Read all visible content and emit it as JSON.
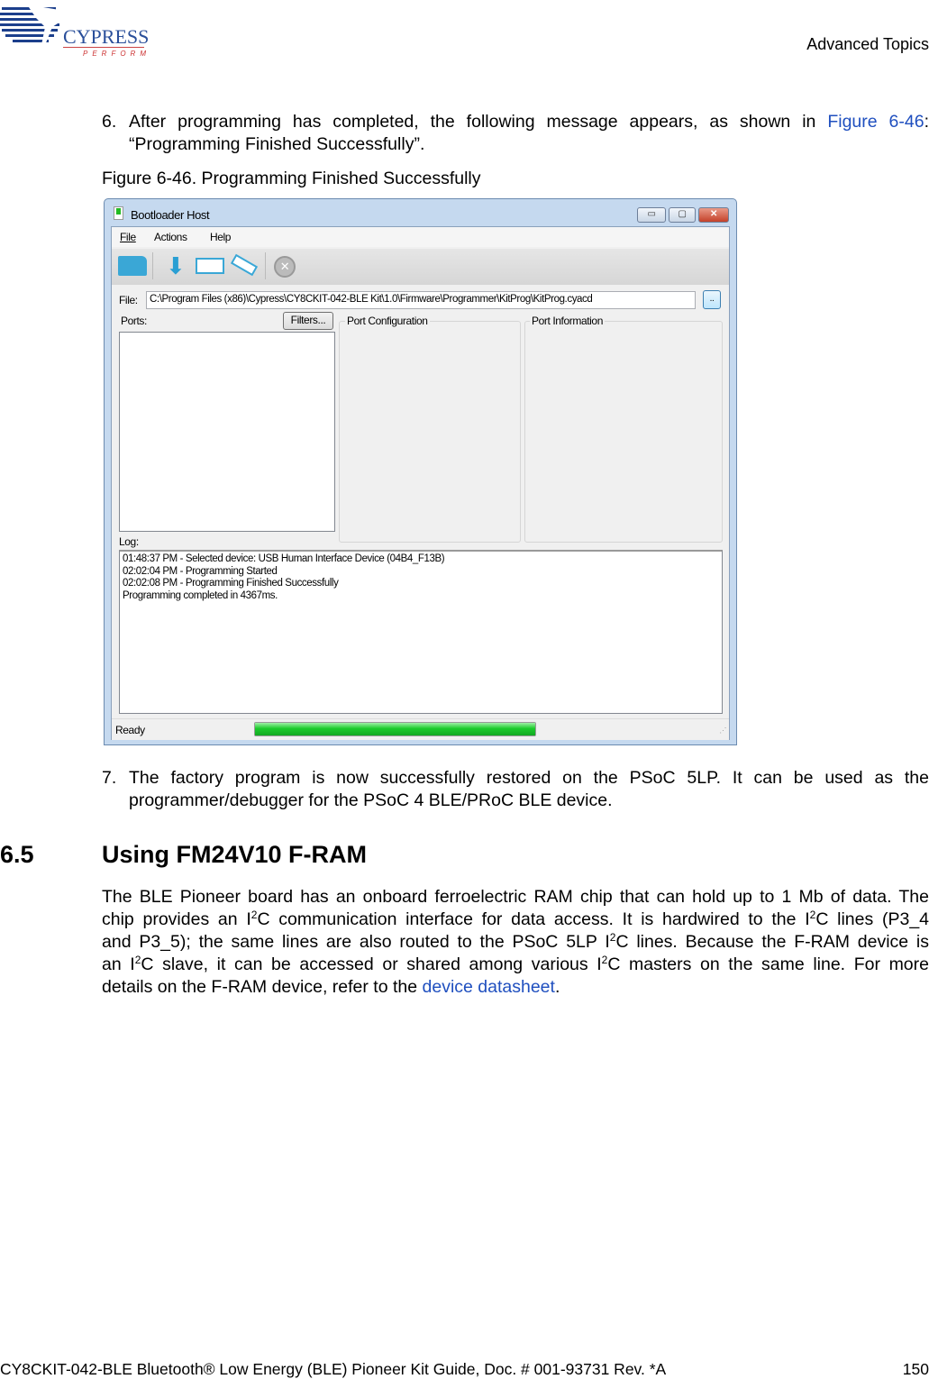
{
  "header": {
    "logo_text": "CYPRESS",
    "logo_tagline": "PERFORM",
    "section": "Advanced Topics"
  },
  "step6": {
    "num": "6.",
    "text_before": "After programming has completed, the following message appears, as shown in ",
    "link": "Figure 6-46",
    "text_after": ":",
    "line2": "“Programming Finished Successfully”."
  },
  "figure": {
    "caption": "Figure 6-46.  Programming Finished Successfully"
  },
  "app": {
    "title": "Bootloader Host",
    "window_buttons": {
      "minimize": "▭",
      "maximize": "▢",
      "close": "✕"
    },
    "menu": [
      "File",
      "Actions",
      "Help"
    ],
    "toolbar": [
      "open-folder-icon",
      "program-icon",
      "verify-icon",
      "erase-icon",
      "abort-icon"
    ],
    "file_label": "File:",
    "file_value": "C:\\Program Files (x86)\\Cypress\\CY8CKIT-042-BLE Kit\\1.0\\Firmware\\Programmer\\KitProg\\KitProg.cyacd",
    "browse_label": "..",
    "ports_label": "Ports:",
    "filters_label": "Filters...",
    "port_config_label": "Port Configuration",
    "port_info_label": "Port Information",
    "log_label": "Log:",
    "log_lines": [
      "01:48:37 PM - Selected device: USB Human Interface Device (04B4_F13B)",
      "02:02:04 PM - Programming Started",
      "02:02:08 PM - Programming Finished Successfully",
      "Programming completed in 4367ms."
    ],
    "status": "Ready",
    "progress_percent": 100,
    "progress_color": "#1ccb2c"
  },
  "step7": {
    "num": "7.",
    "line1": "The factory program is now successfully restored on the PSoC 5LP. It can be used as the",
    "line2": "programmer/debugger for the PSoC 4 BLE/PRoC BLE device."
  },
  "section": {
    "num": "6.5",
    "title": "Using FM24V10 F-RAM"
  },
  "para": {
    "l1": "The BLE Pioneer board has an onboard ferroelectric RAM chip that can hold up to 1 Mb of data. The",
    "l2a": "chip provides an I",
    "l2b": "C communication interface for data access. It is hardwired to the I",
    "l2c": "C lines (P3_4",
    "l3a": "and P3_5); the same lines are also routed to the PSoC 5LP I",
    "l3b": "C lines. Because the F-RAM device is",
    "l4a": "an I",
    "l4b": "C slave, it can be accessed or shared among various I",
    "l4c": "C masters on the same line. For more",
    "l5a": "details on the F-RAM device, refer to the ",
    "l5link": "device datasheet",
    "l5b": ".",
    "sup": "2"
  },
  "footer": {
    "doc": "CY8CKIT-042-BLE Bluetooth® Low Energy (BLE) Pioneer Kit Guide, Doc. # 001-93731 Rev. *A",
    "page": "150"
  }
}
